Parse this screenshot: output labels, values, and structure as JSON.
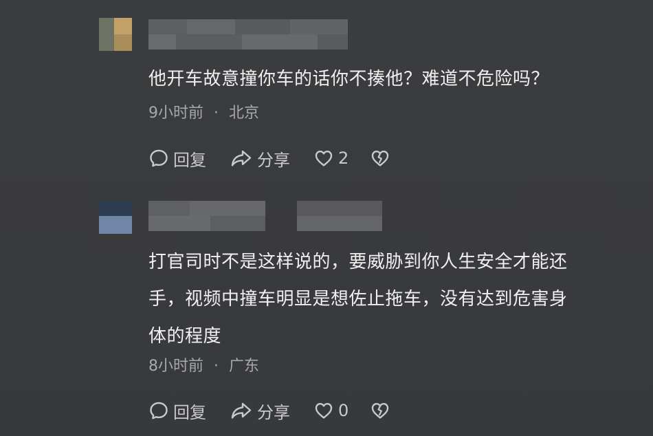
{
  "comments": [
    {
      "avatar_colors": [
        "#8c8f7e",
        "#c9a868",
        "#a99362"
      ],
      "text": "他开车故意撞你车的话你不揍他？难道不危险吗？",
      "time": "9小时前",
      "location": "北京",
      "reply_label": "回复",
      "share_label": "分享",
      "like_count": "2"
    },
    {
      "avatar_colors": [
        "#2e4157",
        "#6f87a8",
        "#4d6683"
      ],
      "text": "打官司时不是这样说的，要威胁到你人生安全才能还\n手，视频中撞车明显是想佐止拖车，没有达到危害身\n体的程度",
      "time": "8小时前",
      "location": "广东",
      "reply_label": "回复",
      "share_label": "分享",
      "like_count": "0"
    }
  ],
  "meta_separator": "·",
  "icons": {
    "reply": "comment-bubble-icon",
    "share": "share-arrow-icon",
    "like": "heart-icon",
    "dislike": "broken-heart-icon"
  },
  "colors": {
    "background": "#3a3b3e",
    "text": "#f0f0f1",
    "meta": "#a7a8ab",
    "action": "#c9cacc"
  }
}
